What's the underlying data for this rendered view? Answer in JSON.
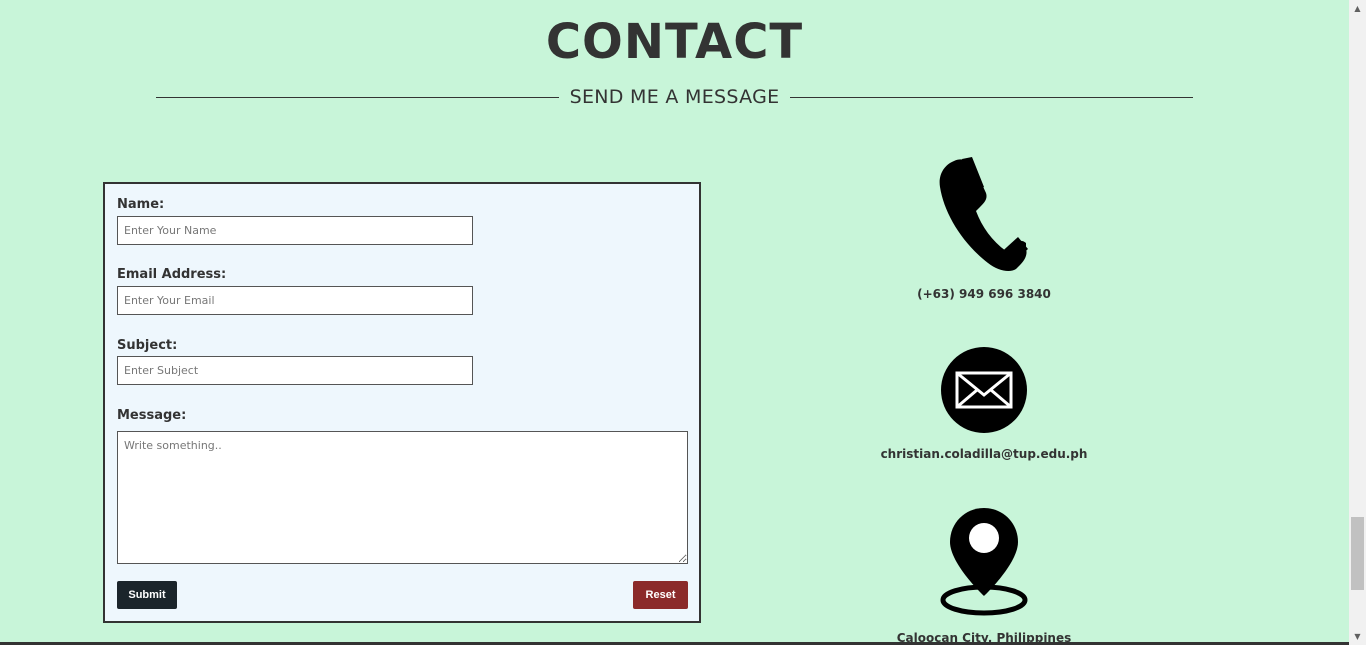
{
  "header": {
    "title": "CONTACT",
    "subtitle": "SEND ME A MESSAGE"
  },
  "form": {
    "name_label": "Name:",
    "name_placeholder": "Enter Your Name",
    "email_label": "Email Address:",
    "email_placeholder": "Enter Your Email",
    "subject_label": "Subject:",
    "subject_placeholder": "Enter Subject",
    "message_label": "Message:",
    "message_placeholder": "Write something..",
    "submit_label": "Submit",
    "reset_label": "Reset"
  },
  "contact_info": {
    "phone": "(+63) 949 696 3840",
    "email": "christian.coladilla@tup.edu.ph",
    "location": "Caloocan City, Philippines"
  },
  "icons": {
    "phone": "phone-icon",
    "email": "envelope-icon",
    "location": "map-pin-icon"
  },
  "colors": {
    "background": "#c8f5d9",
    "card": "#eef7fd",
    "submit": "#1b252b",
    "reset": "#8b2a2a"
  }
}
